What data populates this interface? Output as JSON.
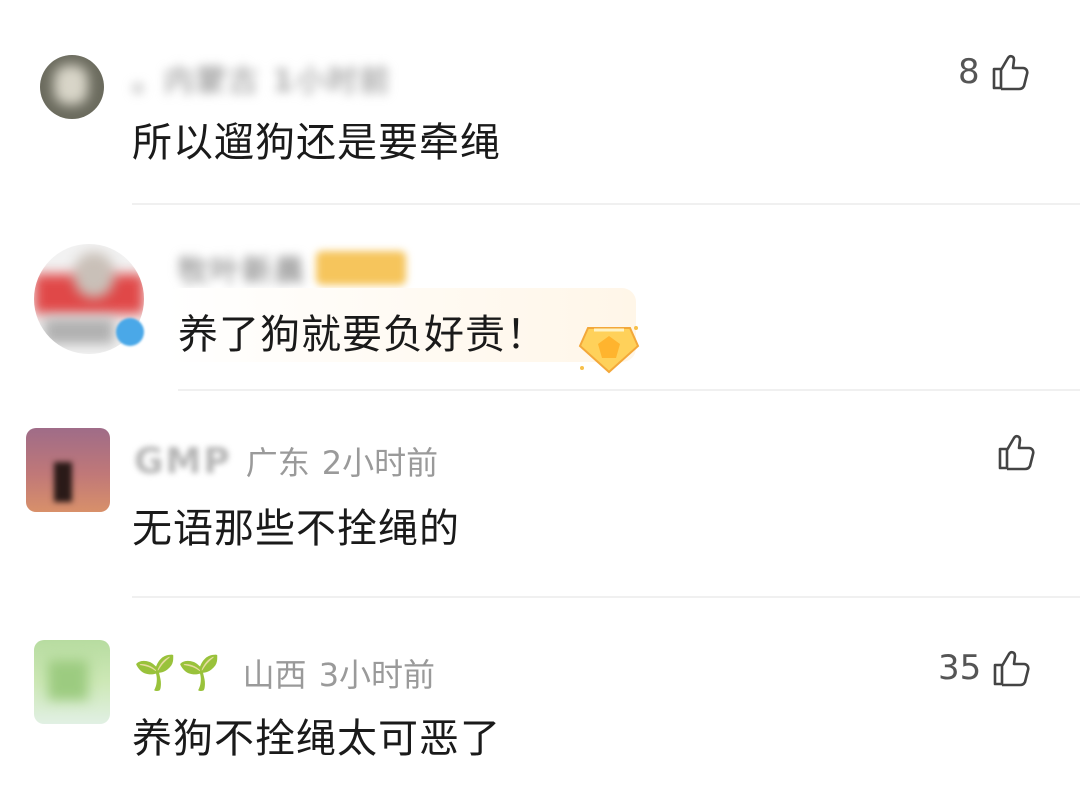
{
  "comments": [
    {
      "nickname": "。内蒙古 1小时前",
      "text": "所以遛狗还是要牵绳",
      "likes": "8"
    },
    {
      "nickname": "牧叶新晨",
      "text": "养了狗就要负好责！"
    },
    {
      "nickname": "GMP",
      "location": "广东",
      "time": "2小时前",
      "text": "无语那些不拴绳的"
    },
    {
      "nickname_glyph": "🌱🌱",
      "location": "山西",
      "time": "3小时前",
      "text": "养狗不拴绳太可恶了",
      "likes": "35"
    }
  ],
  "icons": {
    "like": "thumbs-up-outline",
    "medal": "gold-pentagon-medal"
  }
}
